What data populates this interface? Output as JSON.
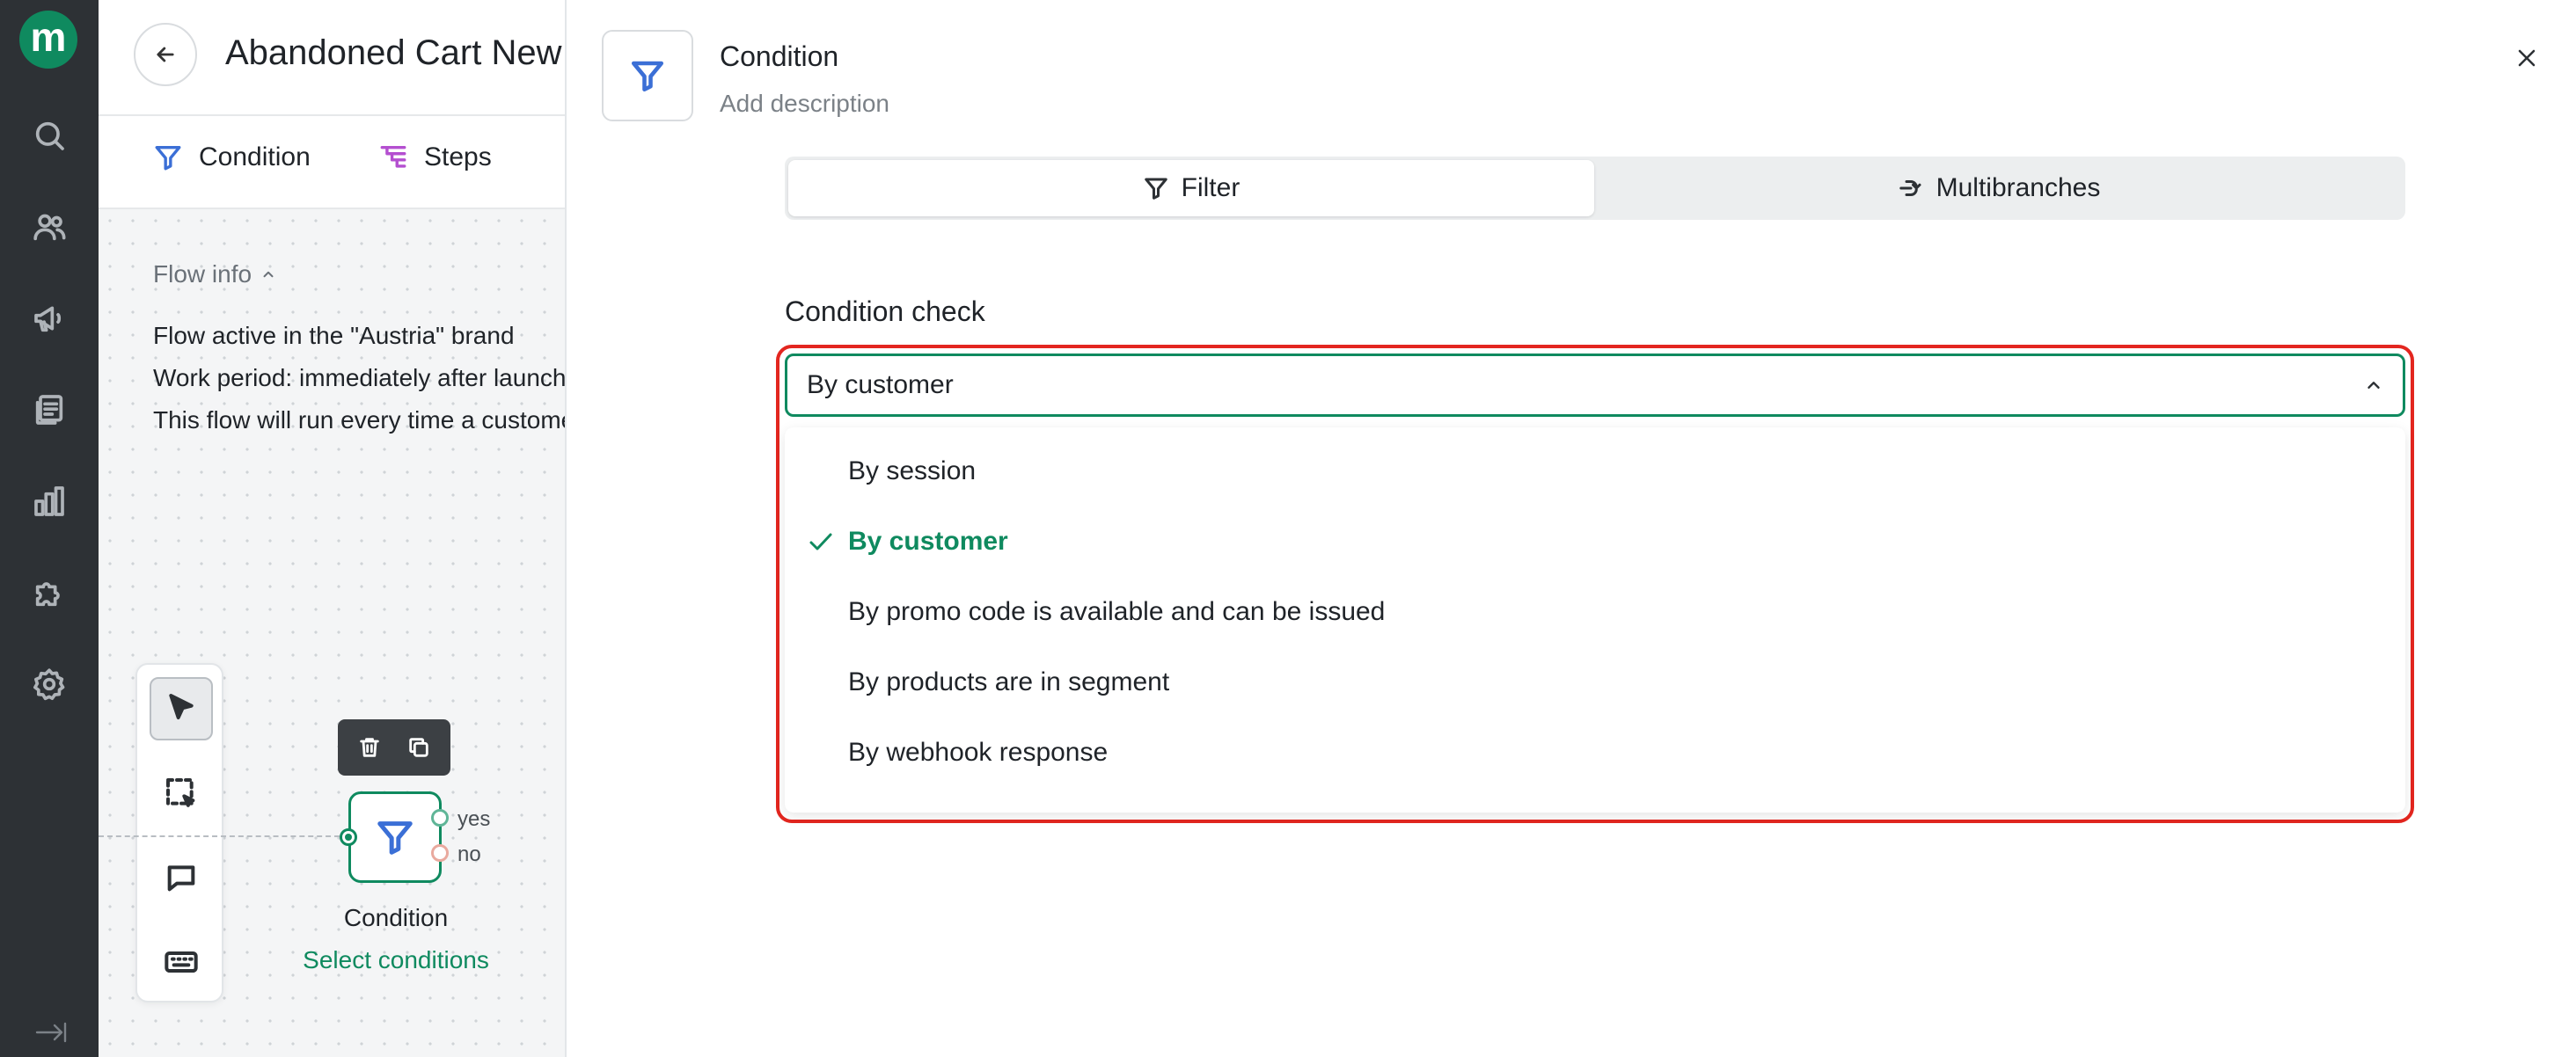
{
  "nav": {
    "logo": "m",
    "items": [
      {
        "icon": "search-icon"
      },
      {
        "icon": "users-icon"
      },
      {
        "icon": "megaphone-icon"
      },
      {
        "icon": "documents-icon"
      },
      {
        "icon": "analytics-icon"
      },
      {
        "icon": "integrations-icon"
      },
      {
        "icon": "settings-icon"
      }
    ],
    "collapse_icon": "collapse-sidebar-icon"
  },
  "editor": {
    "title": "Abandoned Cart New",
    "toolbar": {
      "condition_label": "Condition",
      "steps_label": "Steps"
    },
    "flow_info": {
      "toggle_label": "Flow info",
      "lines": [
        "Flow active in the \"Austria\" brand",
        "Work period: immediately after launch",
        "This flow will run every time a customer"
      ]
    },
    "node": {
      "title": "Condition",
      "link": "Select conditions",
      "yes_label": "yes",
      "no_label": "no"
    }
  },
  "panel": {
    "title": "Condition",
    "description_placeholder": "Add description",
    "tabs": [
      {
        "label": "Filter",
        "active": true
      },
      {
        "label": "Multibranches",
        "active": false
      }
    ],
    "condition_check": {
      "label": "Condition check",
      "selected_value": "By customer",
      "options": [
        {
          "label": "By session",
          "selected": false
        },
        {
          "label": "By customer",
          "selected": true
        },
        {
          "label": "By promo code is available and can be issued",
          "selected": false
        },
        {
          "label": "By products are in segment",
          "selected": false
        },
        {
          "label": "By webhook response",
          "selected": false
        }
      ]
    }
  },
  "colors": {
    "brand": "#0f8a5f",
    "rail": "#2d3135",
    "highlight": "#e3261f",
    "node_icon": "#3b6fd6",
    "steps_icon": "#b44fd0"
  }
}
